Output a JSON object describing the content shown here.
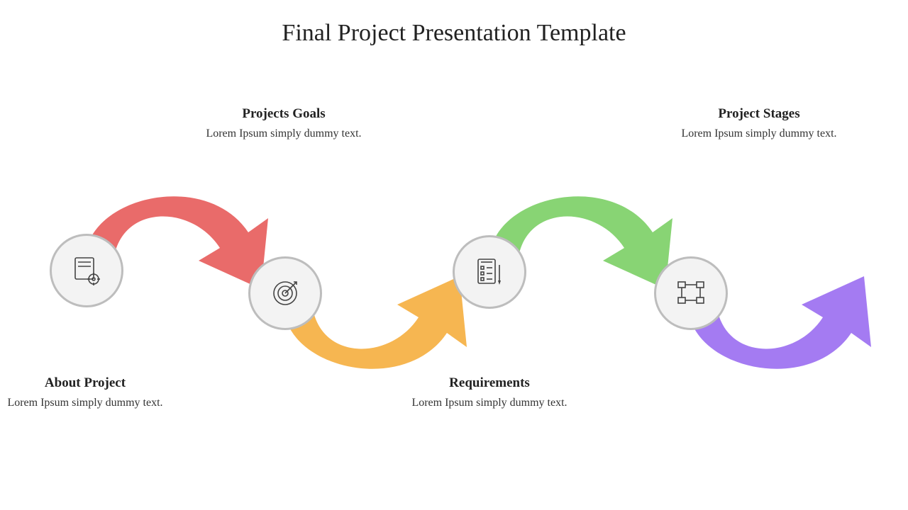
{
  "title": "Final Project Presentation Template",
  "nodes": [
    {
      "id": "about",
      "heading": "About Project",
      "body": "Lorem Ipsum simply dummy text.",
      "icon": "doc-gear",
      "arrow_color": "#e96b6a"
    },
    {
      "id": "goals",
      "heading": "Projects Goals",
      "body": "Lorem Ipsum simply dummy text.",
      "icon": "target",
      "arrow_color": "#f6b651"
    },
    {
      "id": "requirements",
      "heading": "Requirements",
      "body": "Lorem Ipsum simply dummy text.",
      "icon": "checklist",
      "arrow_color": "#88d474"
    },
    {
      "id": "stages",
      "heading": "Project Stages",
      "body": "Lorem Ipsum simply dummy text.",
      "icon": "workflow",
      "arrow_color": "#a47bf2"
    }
  ]
}
